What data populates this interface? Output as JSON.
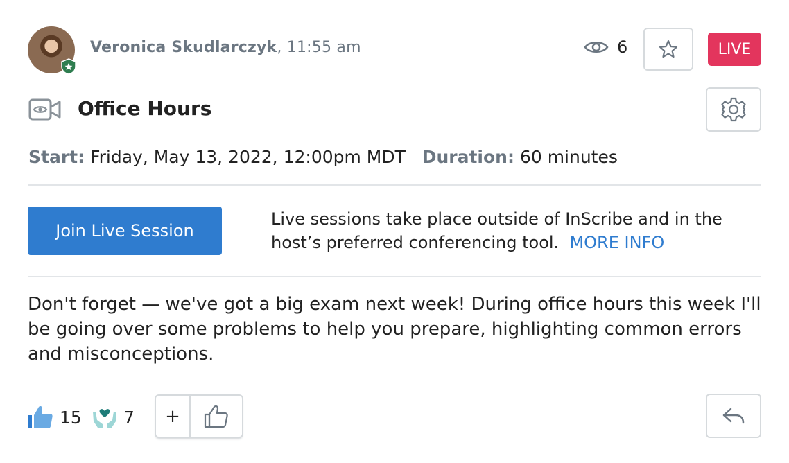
{
  "post": {
    "author": "Veronica Skudlarczyk",
    "time": ", 11:55 am",
    "views": "6",
    "live_label": "LIVE",
    "title": "Office Hours",
    "start_label": "Start:",
    "start_value": "Friday, May 13, 2022, 12:00pm MDT",
    "duration_label": "Duration:",
    "duration_value": "60 minutes",
    "join_label": "Join Live Session",
    "info_text": "Live sessions take place outside of InScribe and in the host’s preferred conferencing tool.",
    "more_info": "MORE INFO",
    "body": "Don't forget — we've got a big exam next week! During office hours this week I'll be going over some problems to help you prepare, highlighting common errors and misconceptions."
  },
  "reactions": {
    "likes": "15",
    "care": "7",
    "add_label": "+"
  },
  "colors": {
    "live": "#e3355d",
    "primary": "#2f7ccf",
    "muted": "#6b7681"
  },
  "icons": [
    "avatar",
    "eye-icon",
    "star-icon",
    "video-camera-icon",
    "gear-icon",
    "thumbs-up-icon",
    "caring-hands-icon",
    "reply-icon"
  ]
}
